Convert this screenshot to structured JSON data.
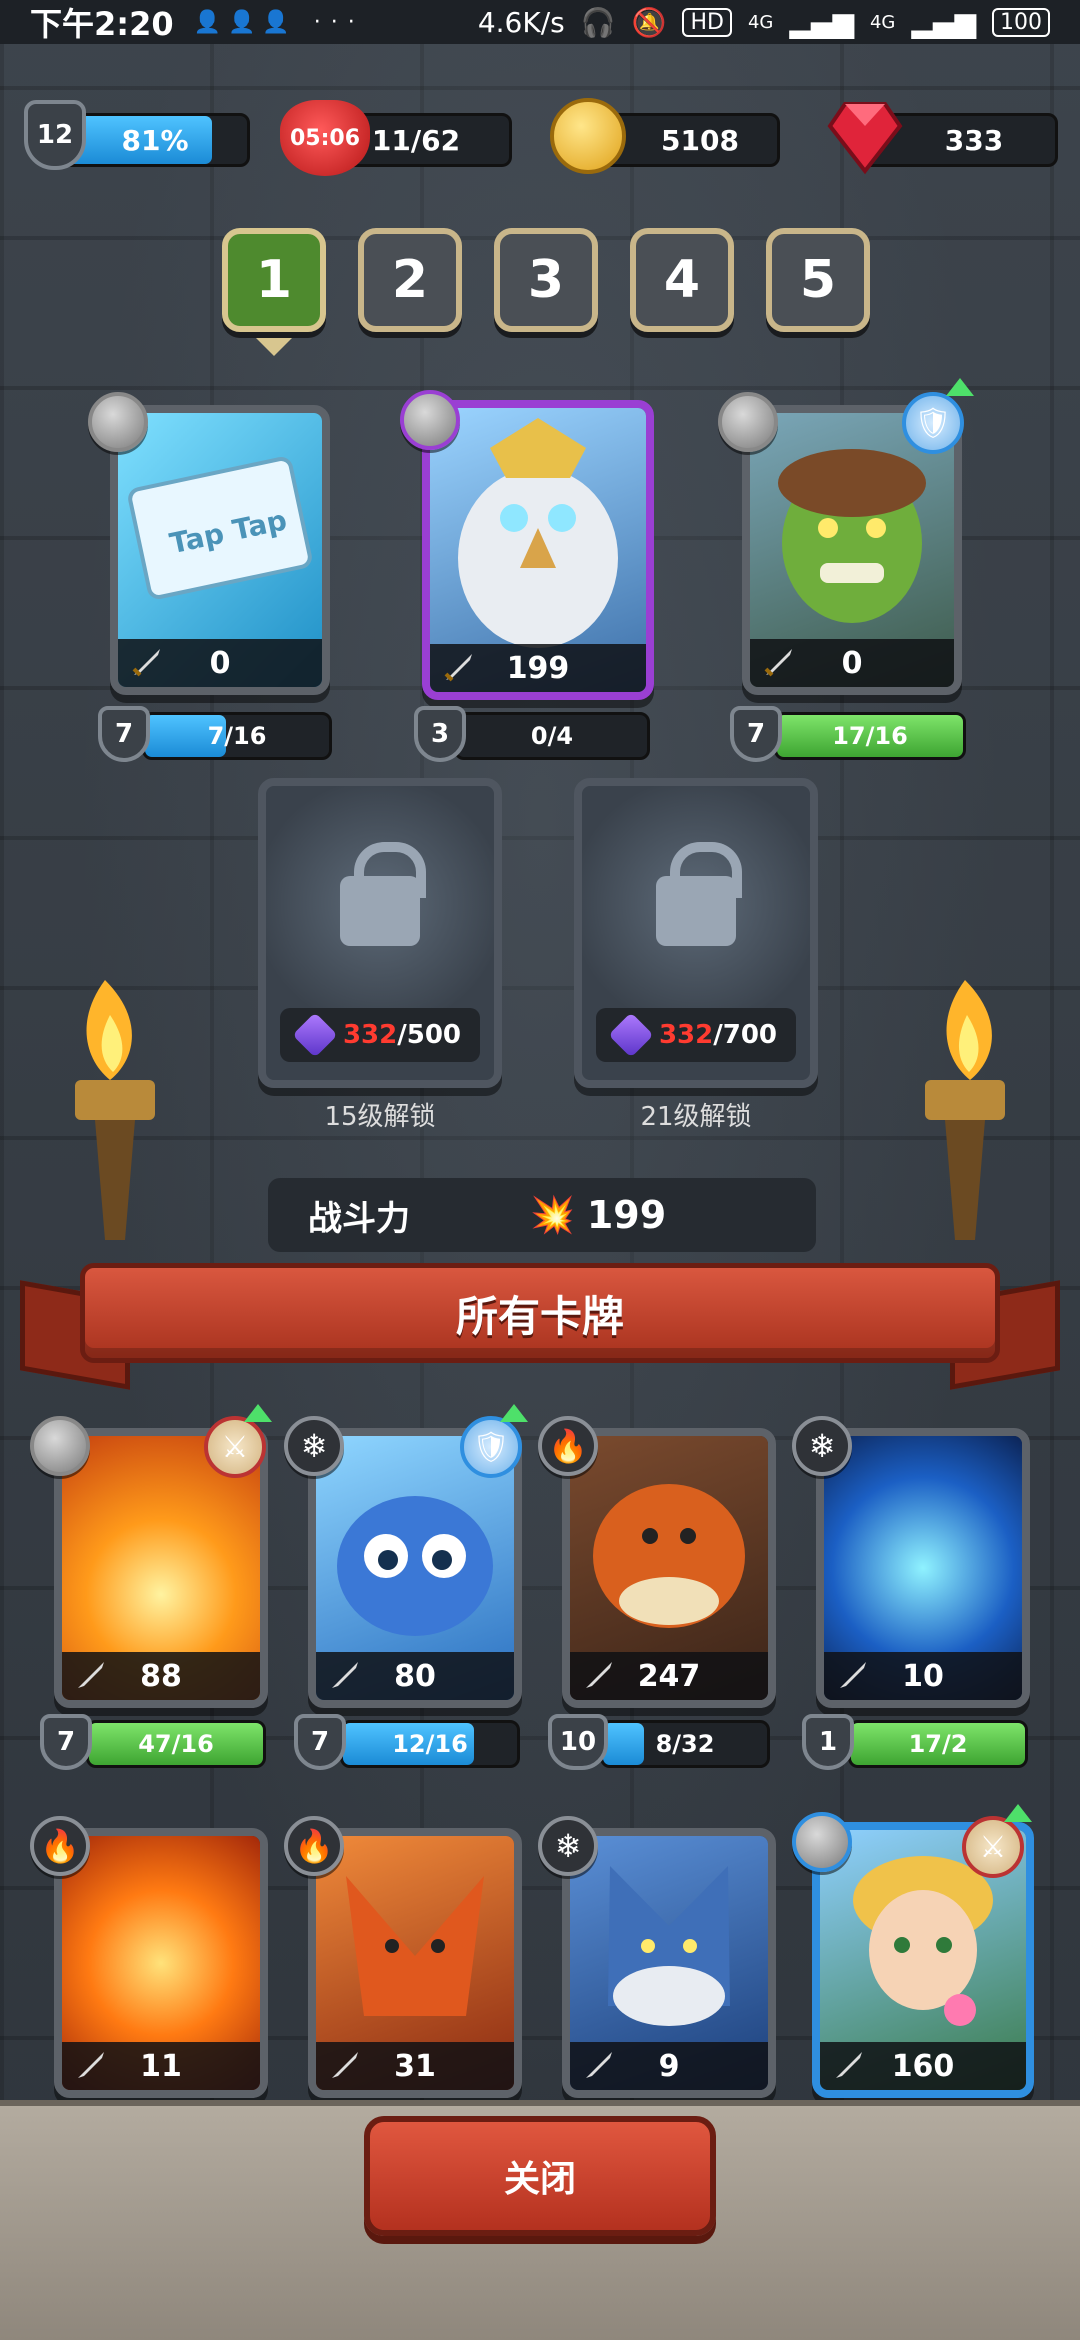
{
  "status_bar": {
    "time": "下午2:20",
    "dots": "···",
    "net_speed": "4.6K/s",
    "hd": "HD",
    "signal1": "4G",
    "signal2": "4G",
    "battery": "100"
  },
  "resources": {
    "player_level": "12",
    "xp_percent": "81%",
    "xp_fill": 0.81,
    "life_timer": "05:06",
    "lives": "11/62",
    "gold": "5108",
    "gems": "333"
  },
  "tabs": [
    {
      "label": "1",
      "active": true
    },
    {
      "label": "2",
      "active": false
    },
    {
      "label": "3",
      "active": false
    },
    {
      "label": "4",
      "active": false
    },
    {
      "label": "5",
      "active": false
    }
  ],
  "team_cards": [
    {
      "power": "0",
      "level": "7",
      "progress": "7/16",
      "fill": 0.44,
      "bar_color": "blue",
      "rarity": "common"
    },
    {
      "power": "199",
      "level": "3",
      "progress": "0/4",
      "fill": 0,
      "bar_color": "blue",
      "rarity": "epic"
    },
    {
      "power": "0",
      "level": "7",
      "progress": "17/16",
      "fill": 1,
      "bar_color": "green",
      "rarity": "common"
    }
  ],
  "locked_slots": [
    {
      "cost_current": "332",
      "cost_total": "/500",
      "label": "15级解锁"
    },
    {
      "cost_current": "332",
      "cost_total": "/700",
      "label": "21级解锁"
    }
  ],
  "combat_power": {
    "label": "战斗力",
    "value": "199"
  },
  "all_cards_title": "所有卡牌",
  "all_cards": [
    {
      "power": "88",
      "level": "7",
      "progress": "47/16",
      "fill": 1,
      "bar_color": "green",
      "element": "neutral"
    },
    {
      "power": "80",
      "level": "7",
      "progress": "12/16",
      "fill": 0.75,
      "bar_color": "blue",
      "element": "ice"
    },
    {
      "power": "247",
      "level": "10",
      "progress": "8/32",
      "fill": 0.25,
      "bar_color": "blue",
      "element": "fire"
    },
    {
      "power": "10",
      "level": "1",
      "progress": "17/2",
      "fill": 1,
      "bar_color": "green",
      "element": "ice"
    },
    {
      "power": "11",
      "element": "fire"
    },
    {
      "power": "31",
      "element": "fire"
    },
    {
      "power": "9",
      "element": "ice"
    },
    {
      "power": "160",
      "element": "neutral"
    }
  ],
  "close_button": "关闭",
  "colors": {
    "accent_red": "#c4402b",
    "green": "#4e8a2e",
    "blue": "#1b8bd6",
    "epic": "#9a3fd3"
  }
}
